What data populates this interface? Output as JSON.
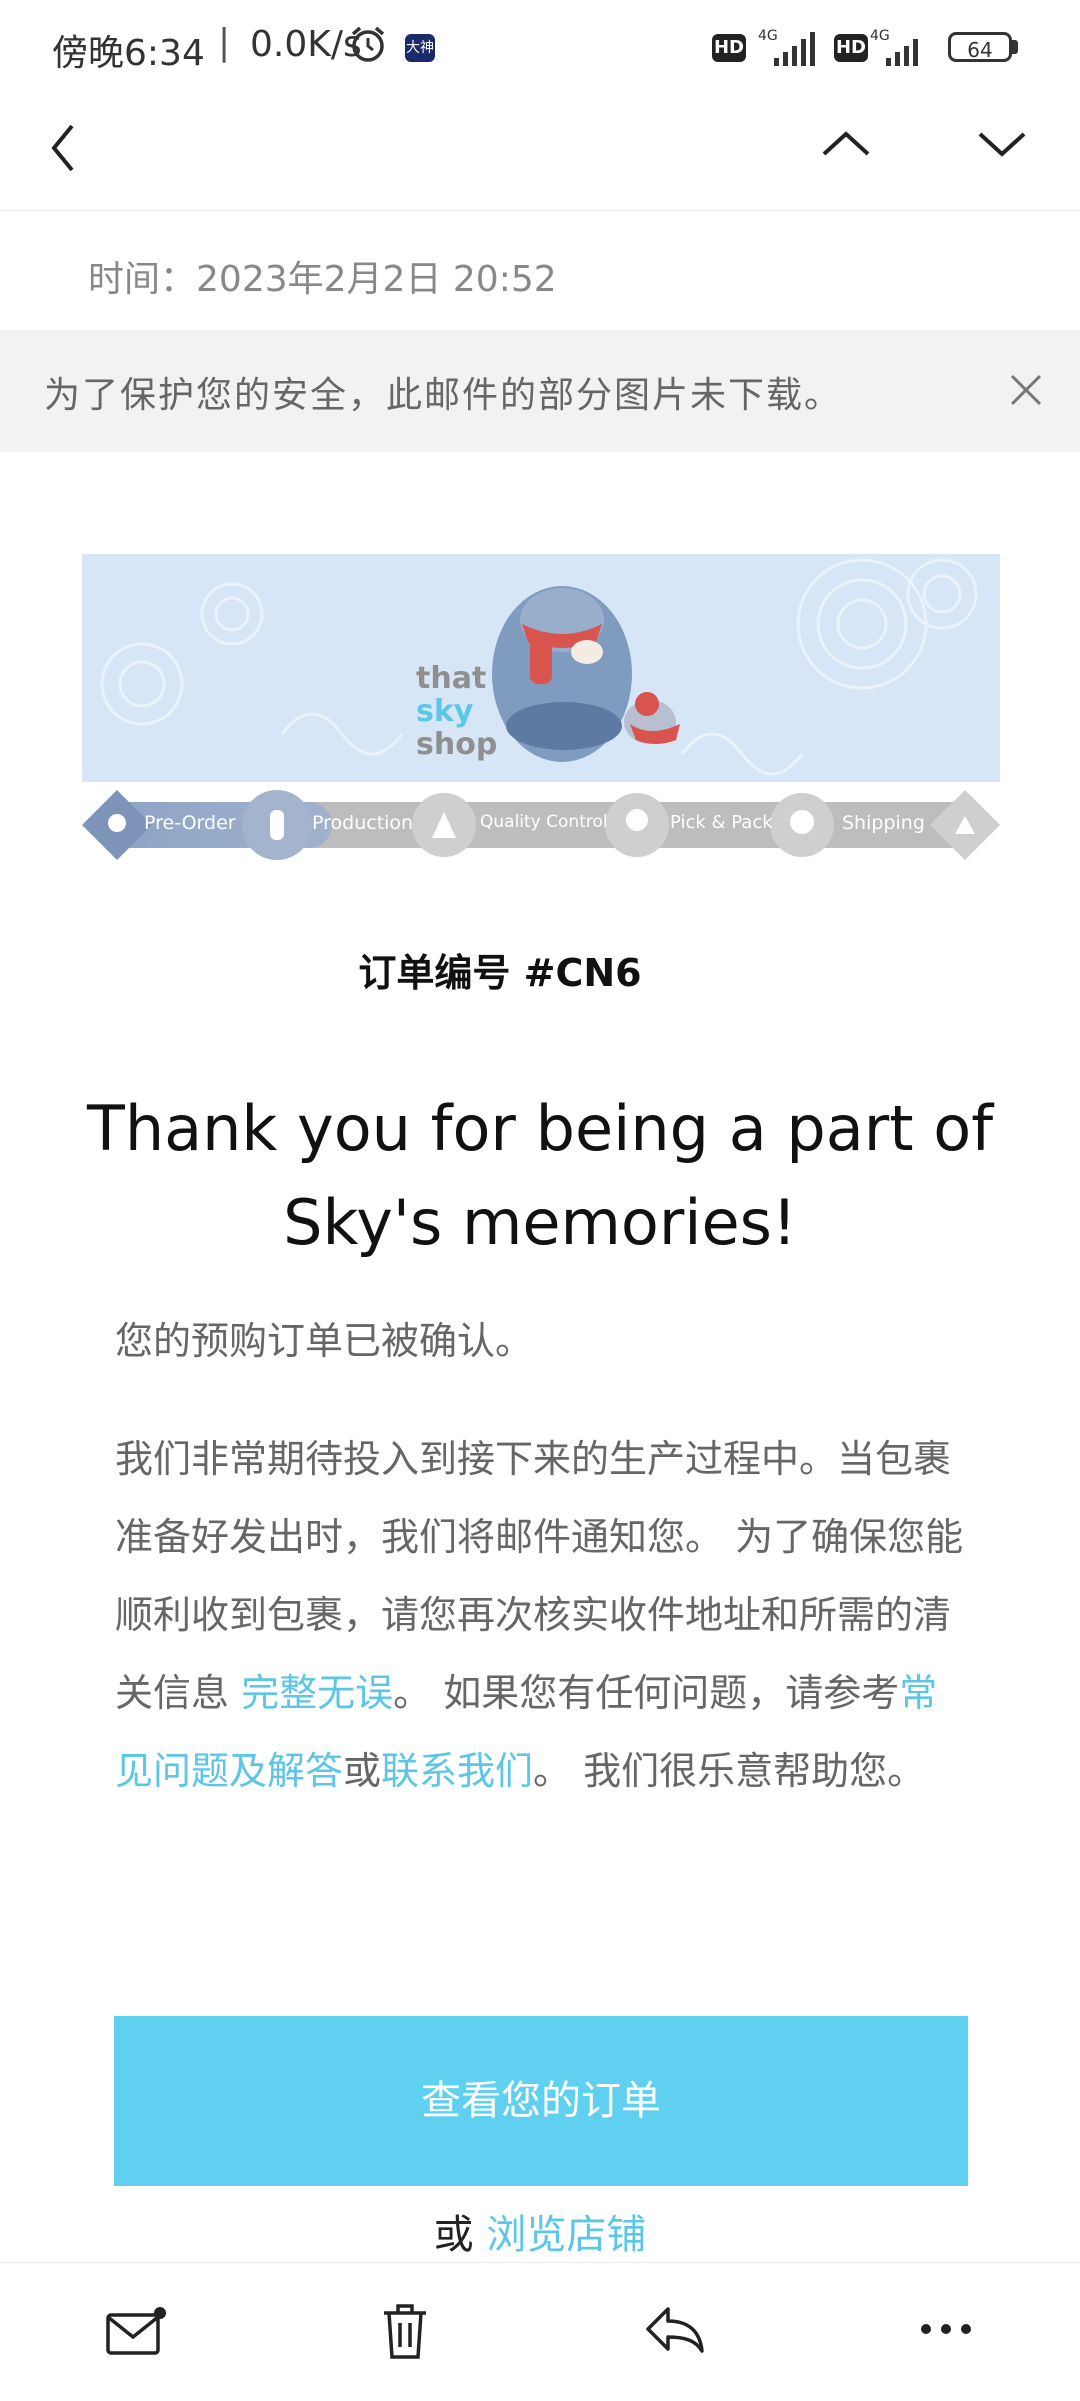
{
  "status_bar": {
    "time": "傍晚6:34",
    "separator": "|",
    "speed": "0.0K/s",
    "app_icon": "大神",
    "hd1": "HD",
    "hd2": "HD",
    "network1": "4G",
    "network2": "4G",
    "battery": "64"
  },
  "nav": {
    "back_icon": "chevron-left-icon",
    "prev_icon": "chevron-up-icon",
    "next_icon": "chevron-down-icon"
  },
  "email": {
    "time_label": "时间：",
    "time_value": "2023年2月2日 20:52",
    "notice": "为了保护您的安全，此邮件的部分图片未下载。",
    "banner": {
      "brand_line1": "that",
      "brand_line2": "sky",
      "brand_line3": "shop",
      "steps": [
        "Pre-Order",
        "Production",
        "Quality Control",
        "Pick & Pack",
        "Shipping"
      ]
    },
    "order_number": "订单编号 #CN6",
    "headline_line1": "Thank you for being a part of",
    "headline_line2": "Sky's memories!",
    "confirm": "您的预购订单已被确认。",
    "body_part1": "我们非常期待投入到接下来的生产过程中。当包裹准备好发出时，我们将邮件通知您。 为了确保您能顺利收到包裹，请您再次核实收件地址和所需的清关信息 ",
    "link_complete": "完整无误",
    "body_part2": "。 如果您有任何问题，请参考",
    "link_faq": "常见问题及解答",
    "body_or": "或",
    "link_contact": "联系我们",
    "body_part3": "。 我们很乐意帮助您。",
    "view_order_button": "查看您的订单",
    "or_text": "或",
    "browse_store_link": "浏览店铺"
  },
  "bottom_bar": {
    "items": [
      "mail-unread-icon",
      "trash-icon",
      "reply-icon",
      "more-icon"
    ]
  },
  "colors": {
    "accent": "#5cc6e6",
    "button": "#5fd0ef",
    "notice_bg": "#f2f2f2",
    "banner_bg": "#d6e6f6"
  }
}
